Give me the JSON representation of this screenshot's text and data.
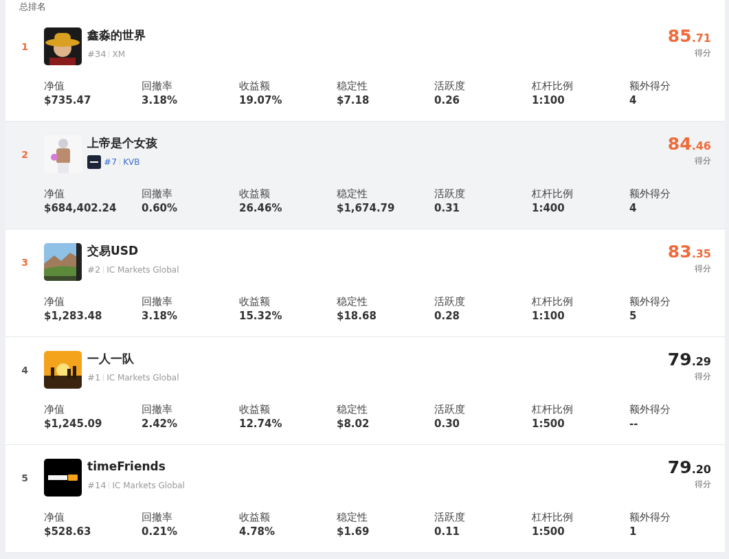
{
  "heading": "总排名",
  "rows": [
    {
      "rank": "1",
      "top_rank": true,
      "selected": false,
      "name": "鑫淼的世界",
      "broker_logo": false,
      "position": "#34",
      "broker": "XM",
      "score_int": "85",
      "score_dec": ".71",
      "score_label": "得分",
      "stats": [
        {
          "label": "净值",
          "value": "$735.47"
        },
        {
          "label": "回撤率",
          "value": "3.18%"
        },
        {
          "label": "收益额",
          "value": "19.07%"
        },
        {
          "label": "稳定性",
          "value": "$7.18"
        },
        {
          "label": "活跃度",
          "value": "0.26"
        },
        {
          "label": "杠杆比例",
          "value": "1:100"
        },
        {
          "label": "额外得分",
          "value": "4"
        }
      ]
    },
    {
      "rank": "2",
      "top_rank": true,
      "selected": true,
      "name": "上帝是个女孩",
      "broker_logo": true,
      "position": "#7",
      "broker": "KVB",
      "score_int": "84",
      "score_dec": ".46",
      "score_label": "得分",
      "stats": [
        {
          "label": "净值",
          "value": "$684,402.24"
        },
        {
          "label": "回撤率",
          "value": "0.60%"
        },
        {
          "label": "收益额",
          "value": "26.46%"
        },
        {
          "label": "稳定性",
          "value": "$1,674.79"
        },
        {
          "label": "活跃度",
          "value": "0.31"
        },
        {
          "label": "杠杆比例",
          "value": "1:400"
        },
        {
          "label": "额外得分",
          "value": "4"
        }
      ]
    },
    {
      "rank": "3",
      "top_rank": true,
      "selected": false,
      "name": "交易USD",
      "broker_logo": false,
      "position": "#2",
      "broker": "IC Markets Global",
      "score_int": "83",
      "score_dec": ".35",
      "score_label": "得分",
      "stats": [
        {
          "label": "净值",
          "value": "$1,283.48"
        },
        {
          "label": "回撤率",
          "value": "3.18%"
        },
        {
          "label": "收益额",
          "value": "15.32%"
        },
        {
          "label": "稳定性",
          "value": "$18.68"
        },
        {
          "label": "活跃度",
          "value": "0.28"
        },
        {
          "label": "杠杆比例",
          "value": "1:100"
        },
        {
          "label": "额外得分",
          "value": "5"
        }
      ]
    },
    {
      "rank": "4",
      "top_rank": false,
      "selected": false,
      "name": "一人一队",
      "broker_logo": false,
      "position": "#1",
      "broker": "IC Markets Global",
      "score_int": "79",
      "score_dec": ".29",
      "score_label": "得分",
      "stats": [
        {
          "label": "净值",
          "value": "$1,245.09"
        },
        {
          "label": "回撤率",
          "value": "2.42%"
        },
        {
          "label": "收益额",
          "value": "12.74%"
        },
        {
          "label": "稳定性",
          "value": "$8.02"
        },
        {
          "label": "活跃度",
          "value": "0.30"
        },
        {
          "label": "杠杆比例",
          "value": "1:500"
        },
        {
          "label": "额外得分",
          "value": "--"
        }
      ]
    },
    {
      "rank": "5",
      "top_rank": false,
      "selected": false,
      "name": "timeFriends",
      "broker_logo": false,
      "position": "#14",
      "broker": "IC Markets Global",
      "score_int": "79",
      "score_dec": ".20",
      "score_label": "得分",
      "stats": [
        {
          "label": "净值",
          "value": "$528.63"
        },
        {
          "label": "回撤率",
          "value": "0.21%"
        },
        {
          "label": "收益额",
          "value": "4.78%"
        },
        {
          "label": "稳定性",
          "value": "$1.69"
        },
        {
          "label": "活跃度",
          "value": "0.11"
        },
        {
          "label": "杠杆比例",
          "value": "1:500"
        },
        {
          "label": "额外得分",
          "value": "1"
        }
      ]
    }
  ]
}
